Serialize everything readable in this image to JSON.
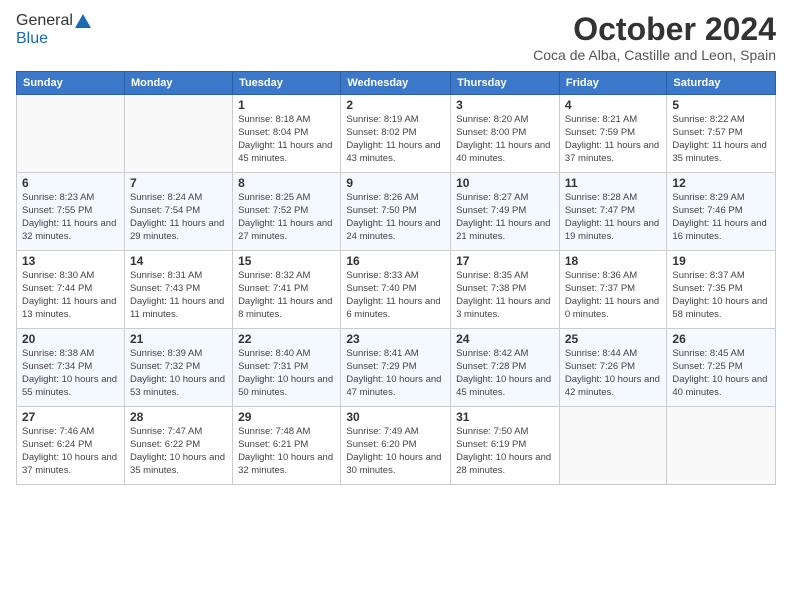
{
  "logo": {
    "line1": "General",
    "line2": "Blue"
  },
  "header": {
    "title": "October 2024",
    "subtitle": "Coca de Alba, Castille and Leon, Spain"
  },
  "weekdays": [
    "Sunday",
    "Monday",
    "Tuesday",
    "Wednesday",
    "Thursday",
    "Friday",
    "Saturday"
  ],
  "weeks": [
    [
      {
        "day": "",
        "info": ""
      },
      {
        "day": "",
        "info": ""
      },
      {
        "day": "1",
        "info": "Sunrise: 8:18 AM\nSunset: 8:04 PM\nDaylight: 11 hours and 45 minutes."
      },
      {
        "day": "2",
        "info": "Sunrise: 8:19 AM\nSunset: 8:02 PM\nDaylight: 11 hours and 43 minutes."
      },
      {
        "day": "3",
        "info": "Sunrise: 8:20 AM\nSunset: 8:00 PM\nDaylight: 11 hours and 40 minutes."
      },
      {
        "day": "4",
        "info": "Sunrise: 8:21 AM\nSunset: 7:59 PM\nDaylight: 11 hours and 37 minutes."
      },
      {
        "day": "5",
        "info": "Sunrise: 8:22 AM\nSunset: 7:57 PM\nDaylight: 11 hours and 35 minutes."
      }
    ],
    [
      {
        "day": "6",
        "info": "Sunrise: 8:23 AM\nSunset: 7:55 PM\nDaylight: 11 hours and 32 minutes."
      },
      {
        "day": "7",
        "info": "Sunrise: 8:24 AM\nSunset: 7:54 PM\nDaylight: 11 hours and 29 minutes."
      },
      {
        "day": "8",
        "info": "Sunrise: 8:25 AM\nSunset: 7:52 PM\nDaylight: 11 hours and 27 minutes."
      },
      {
        "day": "9",
        "info": "Sunrise: 8:26 AM\nSunset: 7:50 PM\nDaylight: 11 hours and 24 minutes."
      },
      {
        "day": "10",
        "info": "Sunrise: 8:27 AM\nSunset: 7:49 PM\nDaylight: 11 hours and 21 minutes."
      },
      {
        "day": "11",
        "info": "Sunrise: 8:28 AM\nSunset: 7:47 PM\nDaylight: 11 hours and 19 minutes."
      },
      {
        "day": "12",
        "info": "Sunrise: 8:29 AM\nSunset: 7:46 PM\nDaylight: 11 hours and 16 minutes."
      }
    ],
    [
      {
        "day": "13",
        "info": "Sunrise: 8:30 AM\nSunset: 7:44 PM\nDaylight: 11 hours and 13 minutes."
      },
      {
        "day": "14",
        "info": "Sunrise: 8:31 AM\nSunset: 7:43 PM\nDaylight: 11 hours and 11 minutes."
      },
      {
        "day": "15",
        "info": "Sunrise: 8:32 AM\nSunset: 7:41 PM\nDaylight: 11 hours and 8 minutes."
      },
      {
        "day": "16",
        "info": "Sunrise: 8:33 AM\nSunset: 7:40 PM\nDaylight: 11 hours and 6 minutes."
      },
      {
        "day": "17",
        "info": "Sunrise: 8:35 AM\nSunset: 7:38 PM\nDaylight: 11 hours and 3 minutes."
      },
      {
        "day": "18",
        "info": "Sunrise: 8:36 AM\nSunset: 7:37 PM\nDaylight: 11 hours and 0 minutes."
      },
      {
        "day": "19",
        "info": "Sunrise: 8:37 AM\nSunset: 7:35 PM\nDaylight: 10 hours and 58 minutes."
      }
    ],
    [
      {
        "day": "20",
        "info": "Sunrise: 8:38 AM\nSunset: 7:34 PM\nDaylight: 10 hours and 55 minutes."
      },
      {
        "day": "21",
        "info": "Sunrise: 8:39 AM\nSunset: 7:32 PM\nDaylight: 10 hours and 53 minutes."
      },
      {
        "day": "22",
        "info": "Sunrise: 8:40 AM\nSunset: 7:31 PM\nDaylight: 10 hours and 50 minutes."
      },
      {
        "day": "23",
        "info": "Sunrise: 8:41 AM\nSunset: 7:29 PM\nDaylight: 10 hours and 47 minutes."
      },
      {
        "day": "24",
        "info": "Sunrise: 8:42 AM\nSunset: 7:28 PM\nDaylight: 10 hours and 45 minutes."
      },
      {
        "day": "25",
        "info": "Sunrise: 8:44 AM\nSunset: 7:26 PM\nDaylight: 10 hours and 42 minutes."
      },
      {
        "day": "26",
        "info": "Sunrise: 8:45 AM\nSunset: 7:25 PM\nDaylight: 10 hours and 40 minutes."
      }
    ],
    [
      {
        "day": "27",
        "info": "Sunrise: 7:46 AM\nSunset: 6:24 PM\nDaylight: 10 hours and 37 minutes."
      },
      {
        "day": "28",
        "info": "Sunrise: 7:47 AM\nSunset: 6:22 PM\nDaylight: 10 hours and 35 minutes."
      },
      {
        "day": "29",
        "info": "Sunrise: 7:48 AM\nSunset: 6:21 PM\nDaylight: 10 hours and 32 minutes."
      },
      {
        "day": "30",
        "info": "Sunrise: 7:49 AM\nSunset: 6:20 PM\nDaylight: 10 hours and 30 minutes."
      },
      {
        "day": "31",
        "info": "Sunrise: 7:50 AM\nSunset: 6:19 PM\nDaylight: 10 hours and 28 minutes."
      },
      {
        "day": "",
        "info": ""
      },
      {
        "day": "",
        "info": ""
      }
    ]
  ]
}
